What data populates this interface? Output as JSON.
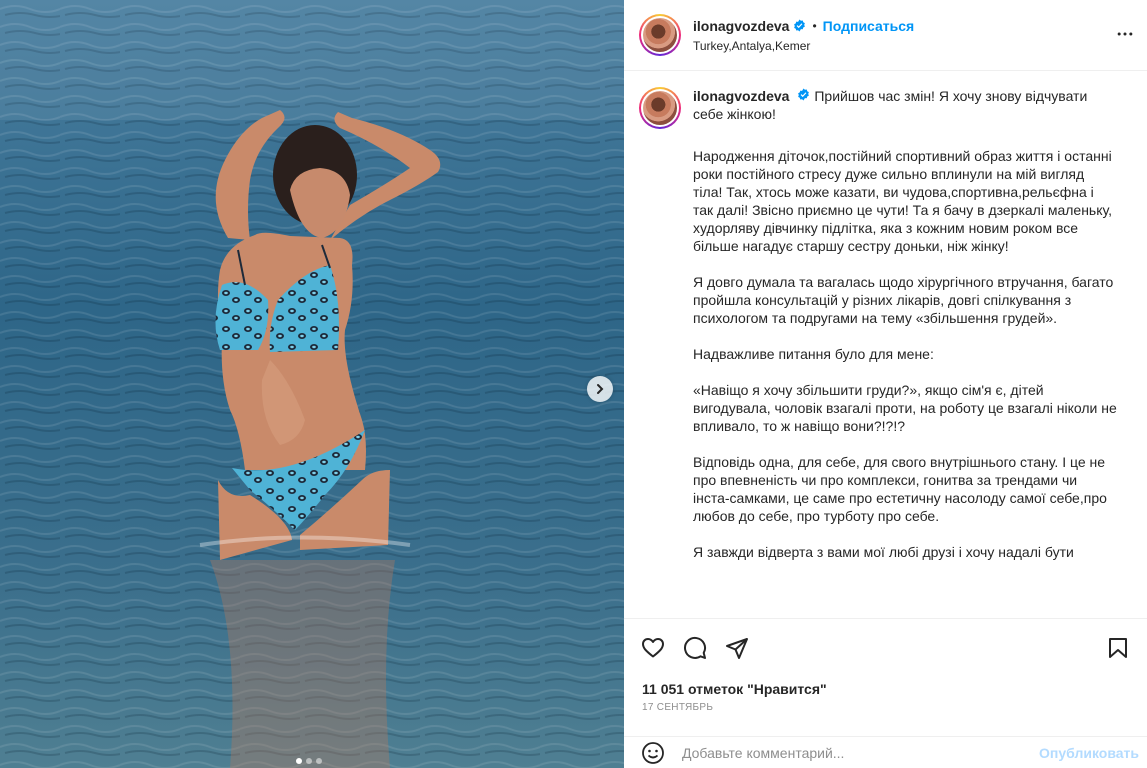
{
  "post": {
    "username": "ilonagvozdeva",
    "separator": "•",
    "follow_label": "Подписаться",
    "location": "Turkey,Antalya,Kemer"
  },
  "caption": {
    "first_line": "Прийшов час змін! Я хочу знову відчувати себе жінкою!",
    "paragraphs": [
      "Народження діточок,постійний спортивний образ життя і останні роки постійного стресу дуже сильно вплинули на мій вигляд тіла! Так, хтось може казати, ви чудова,спортивна,рельєфна і так далі! Звісно приємно це чути! Та я бачу в дзеркалі маленьку, худорляву дівчинку підлітка, яка з кожним новим роком все більше нагадує старшу сестру доньки, ніж жінку!",
      "Я довго думала та вагалась щодо хірургічного втручання, багато пройшла консультацій у різних лікарів, довгі спілкування з психологом та подругами на тему «збільшення грудей».",
      "Надважливе питання було для мене:",
      "«Навіщо я хочу збільшити груди?», якщо сім'я є, дітей вигодувала, чоловік взагалі проти, на роботу це взагалі ніколи не впливало, то ж навіщо вони?!?!?",
      "Відповідь одна, для себе, для свого внутрішнього стану. І це не про впевненість чи про комплекси, гонитва за трендами чи інста-самками, це саме про естетичну насолоду самої себе,про любов до себе, про турботу про себе.",
      "Я завжди відверта з вами мої любі друзі і хочу надалі бути"
    ]
  },
  "engagement": {
    "likes": "11 051 отметок \"Нравится\"",
    "date": "17 СЕНТЯБРЬ"
  },
  "comment": {
    "placeholder": "Добавьте комментарий...",
    "publish_label": "Опубликовать"
  },
  "carousel": {
    "dot_count": 3,
    "active_index": 0
  },
  "icons": {
    "verified": "verified-badge-icon",
    "more": "more-options-icon",
    "like": "heart-icon",
    "comment": "comment-icon",
    "share": "share-icon",
    "save": "bookmark-icon",
    "emoji": "emoji-icon",
    "next": "chevron-right-icon"
  },
  "colors": {
    "accent": "#0095f6",
    "verified": "#0095f6",
    "publish_disabled": "#b3dbff",
    "muted": "#8e8e8e"
  }
}
